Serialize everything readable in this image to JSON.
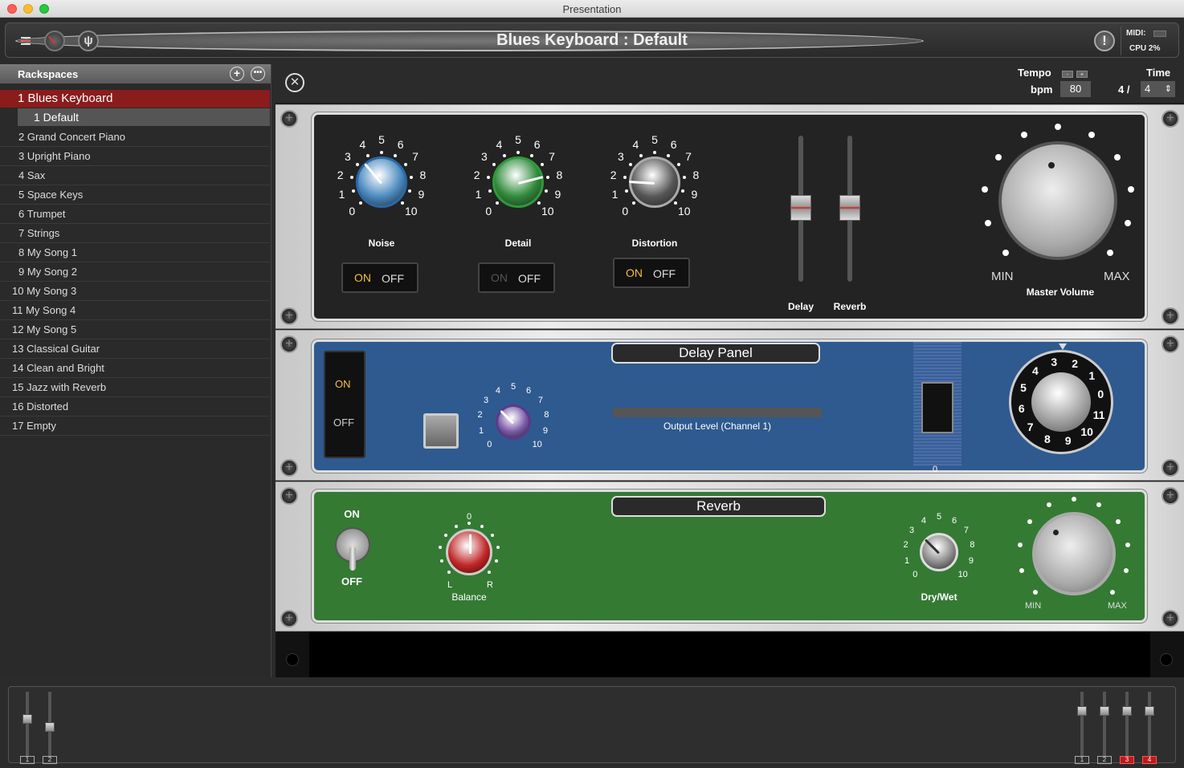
{
  "window": {
    "title": "Presentation"
  },
  "header": {
    "song_title": "Blues Keyboard : Default",
    "midi_label": "MIDI:",
    "cpu_label": "CPU  2%"
  },
  "sidebar": {
    "title": "Rackspaces",
    "selected": {
      "label": "1 Blues Keyboard"
    },
    "variation": {
      "label": "1   Default"
    },
    "items": [
      "2 Grand Concert Piano",
      "3 Upright Piano",
      "4 Sax",
      "5 Space Keys",
      "6 Trumpet",
      "7 Strings",
      "8 My Song 1",
      "9 My Song 2",
      "10 My Song 3",
      "11 My Song 4",
      "12 My Song 5",
      "13 Classical Guitar",
      "14 Clean and Bright",
      "15 Jazz with Reverb",
      "16 Distorted",
      "17 Empty"
    ]
  },
  "transport": {
    "tempo_label": "Tempo",
    "bpm_label": "bpm",
    "bpm": "80",
    "time_label": "Time",
    "ts_num": "4 /",
    "ts_den": "4",
    "minus": "-",
    "plus": "+"
  },
  "rack1": {
    "noise_label": "Noise",
    "detail_label": "Detail",
    "distortion_label": "Distortion",
    "delay_label": "Delay",
    "reverb_label": "Reverb",
    "master_label": "Master Volume",
    "min": "MIN",
    "max": "MAX",
    "on": "ON",
    "off": "OFF",
    "scale": [
      "0",
      "1",
      "2",
      "3",
      "4",
      "5",
      "6",
      "7",
      "8",
      "9",
      "10"
    ],
    "noise_value": 3.5,
    "detail_value": 7.8,
    "distortion_value": 1.8
  },
  "rack2": {
    "title": "Delay Panel",
    "on": "ON",
    "off": "OFF",
    "output_label": "Output Level (Channel 1)",
    "meter_value": "0",
    "ring_labels": [
      "3",
      "2",
      "1",
      "0",
      "11",
      "10",
      "9",
      "8",
      "7",
      "6",
      "5",
      "4"
    ]
  },
  "rack3": {
    "title": "Reverb",
    "on": "ON",
    "off": "OFF",
    "balance_label": "Balance",
    "balance_zero": "0",
    "l": "L",
    "r": "R",
    "drywet_label": "Dry/Wet",
    "min": "MIN",
    "max": "MAX"
  },
  "mixer": {
    "left_channels": [
      "1",
      "2"
    ],
    "right_channels": [
      "1",
      "2",
      "3",
      "4"
    ]
  },
  "colors": {
    "accent": "#8a1c1c",
    "noise": "#4a8ac0",
    "detail": "#2e8a3a",
    "distortion": "#555555",
    "delay_panel": "#2e5a8f",
    "reverb_panel": "#347a33"
  }
}
